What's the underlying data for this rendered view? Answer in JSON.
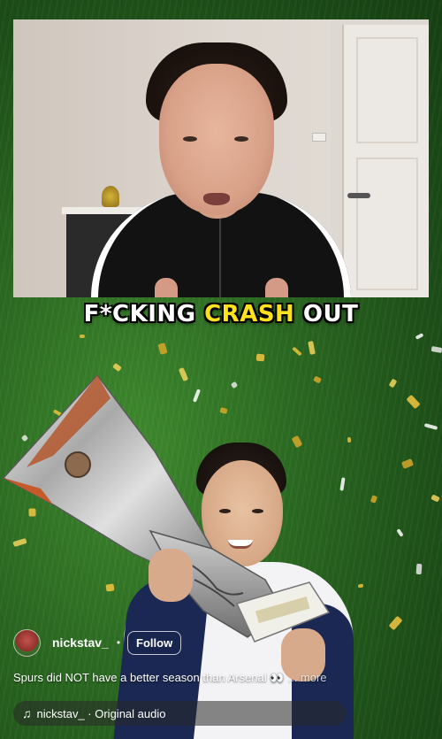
{
  "caption": {
    "part1": "F*CKING ",
    "highlight": "CRASH",
    "part2": " OUT",
    "highlight_color": "#ffe11c"
  },
  "post": {
    "username": "nickstav_",
    "separator": "•",
    "follow_label": "Follow",
    "description": "Spurs did NOT have a better season than Arsenal",
    "emoji": "👀",
    "more_label": "... more"
  },
  "audio": {
    "icon": "music-note-icon",
    "label": "nickstav_ · Original audio"
  },
  "colors": {
    "grass": "#2c6b22",
    "caption_text": "#ffffff",
    "kit_navy": "#1a2853"
  }
}
